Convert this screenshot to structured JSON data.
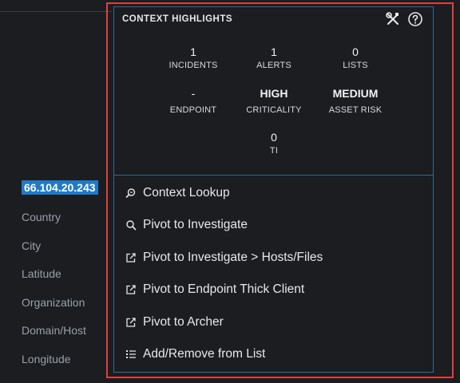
{
  "ip": "66.104.20.243",
  "attributes": [
    "Country",
    "City",
    "Latitude",
    "Organization",
    "Domain/Host",
    "Longitude"
  ],
  "panel": {
    "title": "CONTEXT HIGHLIGHTS",
    "stats": [
      {
        "value": "1",
        "label": "INCIDENTS"
      },
      {
        "value": "1",
        "label": "ALERTS"
      },
      {
        "value": "0",
        "label": "LISTS"
      },
      {
        "value": "-",
        "label": "ENDPOINT"
      },
      {
        "value": "HIGH",
        "label": "CRITICALITY"
      },
      {
        "value": "MEDIUM",
        "label": "ASSET RISK"
      },
      {
        "value": "0",
        "label": "TI"
      }
    ],
    "menu": [
      {
        "label": "Context Lookup",
        "icon": "context-lookup-icon"
      },
      {
        "label": "Pivot to Investigate",
        "icon": "search-icon"
      },
      {
        "label": "Pivot to Investigate > Hosts/Files",
        "icon": "external-link-icon"
      },
      {
        "label": "Pivot to Endpoint Thick Client",
        "icon": "external-link-icon"
      },
      {
        "label": "Pivot to Archer",
        "icon": "external-link-icon"
      },
      {
        "label": "Add/Remove from List",
        "icon": "list-icon"
      }
    ]
  },
  "colors": {
    "background": "#1b1d21",
    "highlight_frame": "#e0403a",
    "panel_border": "#2b6d93",
    "selection": "#1f7ac7"
  }
}
